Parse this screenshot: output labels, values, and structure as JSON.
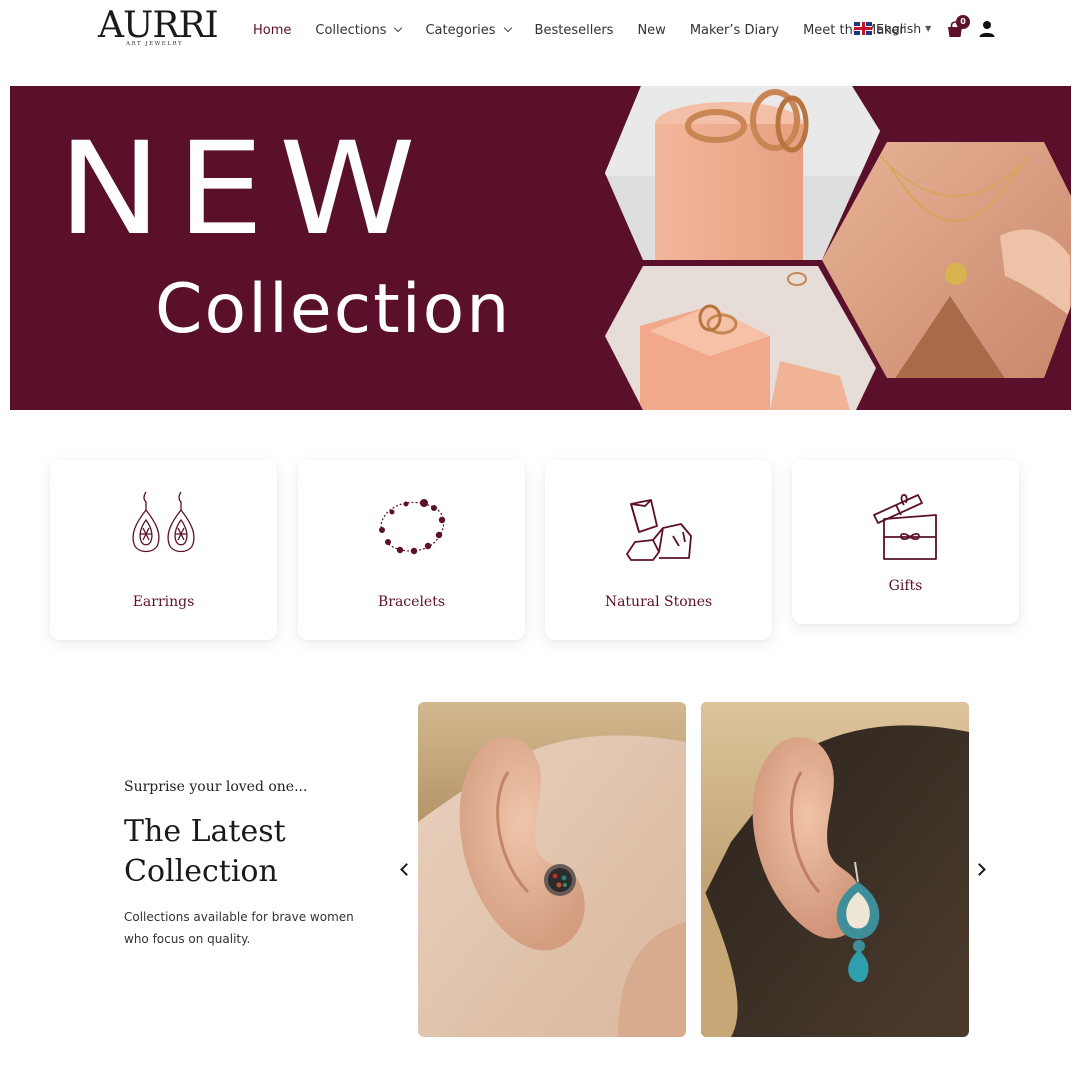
{
  "brand": {
    "logo_word": "AURRI",
    "logo_sub": "ART JEWELRY"
  },
  "nav": {
    "items": [
      {
        "label": "Home",
        "active": true,
        "dropdown": false
      },
      {
        "label": "Collections",
        "active": false,
        "dropdown": true
      },
      {
        "label": "Categories",
        "active": false,
        "dropdown": true
      },
      {
        "label": "Bestesellers",
        "active": false,
        "dropdown": false
      },
      {
        "label": "New",
        "active": false,
        "dropdown": false
      },
      {
        "label": "Maker’s Diary",
        "active": false,
        "dropdown": false
      },
      {
        "label": "Meet the Maker",
        "active": false,
        "dropdown": false
      }
    ],
    "language": "English",
    "cart_count": "0"
  },
  "hero": {
    "headline": "NEW",
    "subline": "Collection"
  },
  "categories": [
    {
      "label": "Earrings",
      "icon": "earrings-icon"
    },
    {
      "label": "Bracelets",
      "icon": "bracelet-icon"
    },
    {
      "label": "Natural Stones",
      "icon": "stones-icon"
    },
    {
      "label": "Gifts",
      "icon": "gift-icon"
    }
  ],
  "promo": {
    "eyebrow": "Surprise your loved one...",
    "title": "The Latest Collection",
    "description": "Collections available for brave women who focus on quality."
  },
  "colors": {
    "brand": "#5c1029",
    "hero_bg": "#5a102b"
  }
}
